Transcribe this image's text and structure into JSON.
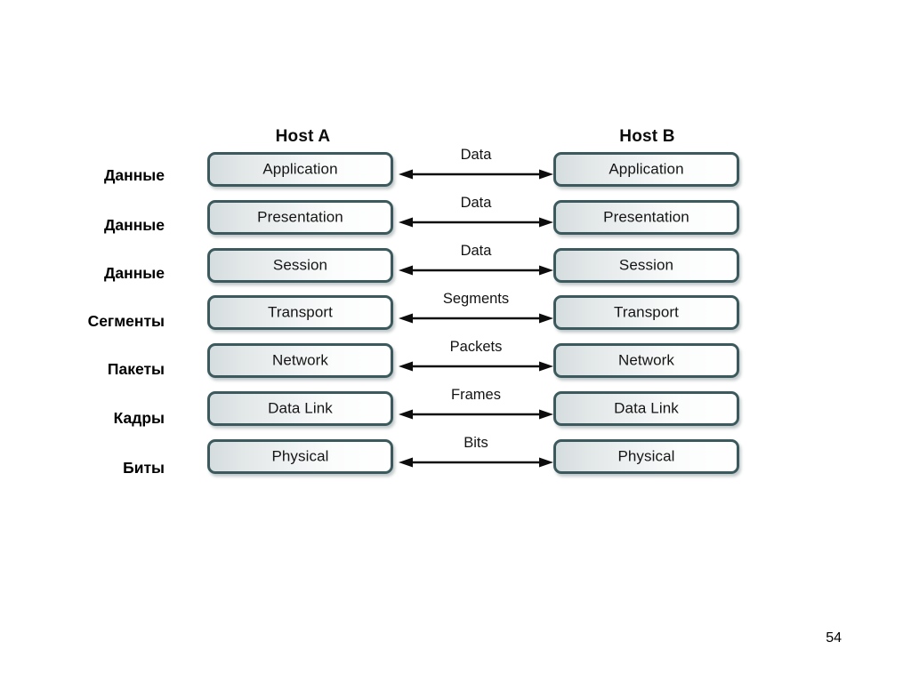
{
  "slide": {
    "page_number": "54",
    "background_color": "#ffffff",
    "box_border_color": "#3c5a5d",
    "text_color": "#151515"
  },
  "diagram": {
    "type": "osi-layer-communication",
    "hosts": [
      {
        "id": "host-a",
        "title": "Host A"
      },
      {
        "id": "host-b",
        "title": "Host B"
      }
    ],
    "pdu_labels": [
      "Данные",
      "Данные",
      "Данные",
      "Сегменты",
      "Пакеты",
      "Кадры",
      "Биты"
    ],
    "layers": [
      "Application",
      "Presentation",
      "Session",
      "Transport",
      "Network",
      "Data Link",
      "Physical"
    ],
    "arrow_captions": [
      "Data",
      "Data",
      "Data",
      "Segments",
      "Packets",
      "Frames",
      "Bits"
    ]
  }
}
